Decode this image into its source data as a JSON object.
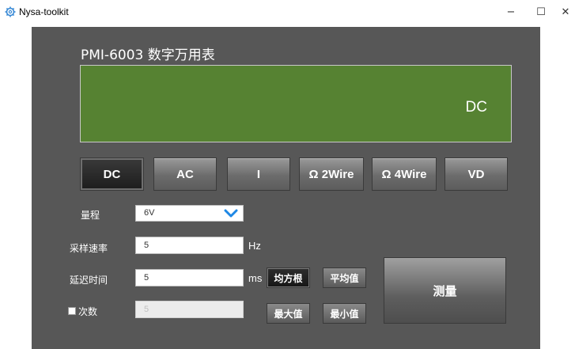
{
  "window": {
    "title": "Nysa-toolkit",
    "minimize_glyph": "−",
    "maximize_glyph": "☐",
    "close_glyph": "✕",
    "icon": "gear-icon"
  },
  "meter": {
    "title": "PMI-6003 数字万用表",
    "display_mode": "DC"
  },
  "modes": [
    {
      "label": "DC",
      "active": true
    },
    {
      "label": "AC",
      "active": false
    },
    {
      "label": "I",
      "active": false
    },
    {
      "label": "Ω 2Wire",
      "active": false
    },
    {
      "label": "Ω 4Wire",
      "active": false
    },
    {
      "label": "VD",
      "active": false
    }
  ],
  "range": {
    "label": "量程",
    "value": "6V",
    "chevron": "chevron-down-icon"
  },
  "sample_rate": {
    "label": "采样速率",
    "value": "5",
    "unit": "Hz"
  },
  "delay": {
    "label": "延迟时间",
    "value": "5",
    "unit": "ms"
  },
  "count": {
    "label": "次数",
    "value": "5",
    "checked": false
  },
  "stats_buttons": {
    "rms": "均方根",
    "mean": "平均值",
    "max": "最大值",
    "min": "最小值"
  },
  "measure_button": "测量",
  "colors": {
    "panel": "#575757",
    "display": "#568232",
    "chevron": "#1e88e5"
  }
}
